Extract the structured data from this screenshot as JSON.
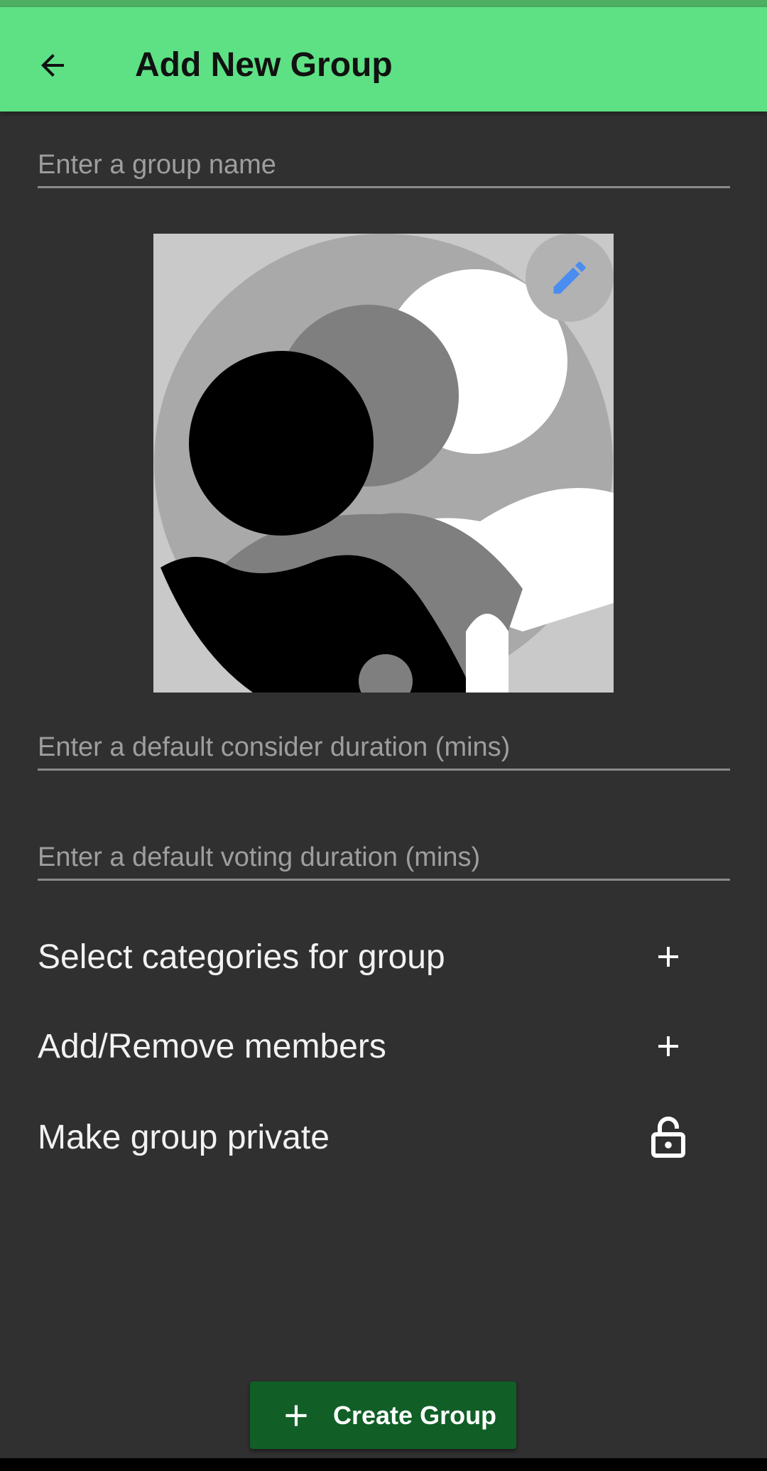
{
  "header": {
    "back_icon": "arrow-left-icon",
    "title": "Add New Group"
  },
  "form": {
    "group_name": {
      "value": "",
      "placeholder": "Enter a group name"
    },
    "group_image": {
      "edit_icon": "pencil-icon"
    },
    "consider_duration": {
      "value": "",
      "placeholder": "Enter a default consider duration (mins)"
    },
    "voting_duration": {
      "value": "",
      "placeholder": "Enter a default voting duration (mins)"
    }
  },
  "options": {
    "categories": {
      "label": "Select categories for group",
      "icon": "plus-icon"
    },
    "members": {
      "label": "Add/Remove members",
      "icon": "plus-icon"
    },
    "privacy": {
      "label": "Make group private",
      "icon": "unlocked-lock-icon"
    }
  },
  "actions": {
    "create_label": "Create Group",
    "create_icon": "plus-icon"
  },
  "colors": {
    "app_bar": "#5de184",
    "background": "#303030",
    "create_button": "#115f27",
    "edit_icon": "#4a8df0"
  }
}
